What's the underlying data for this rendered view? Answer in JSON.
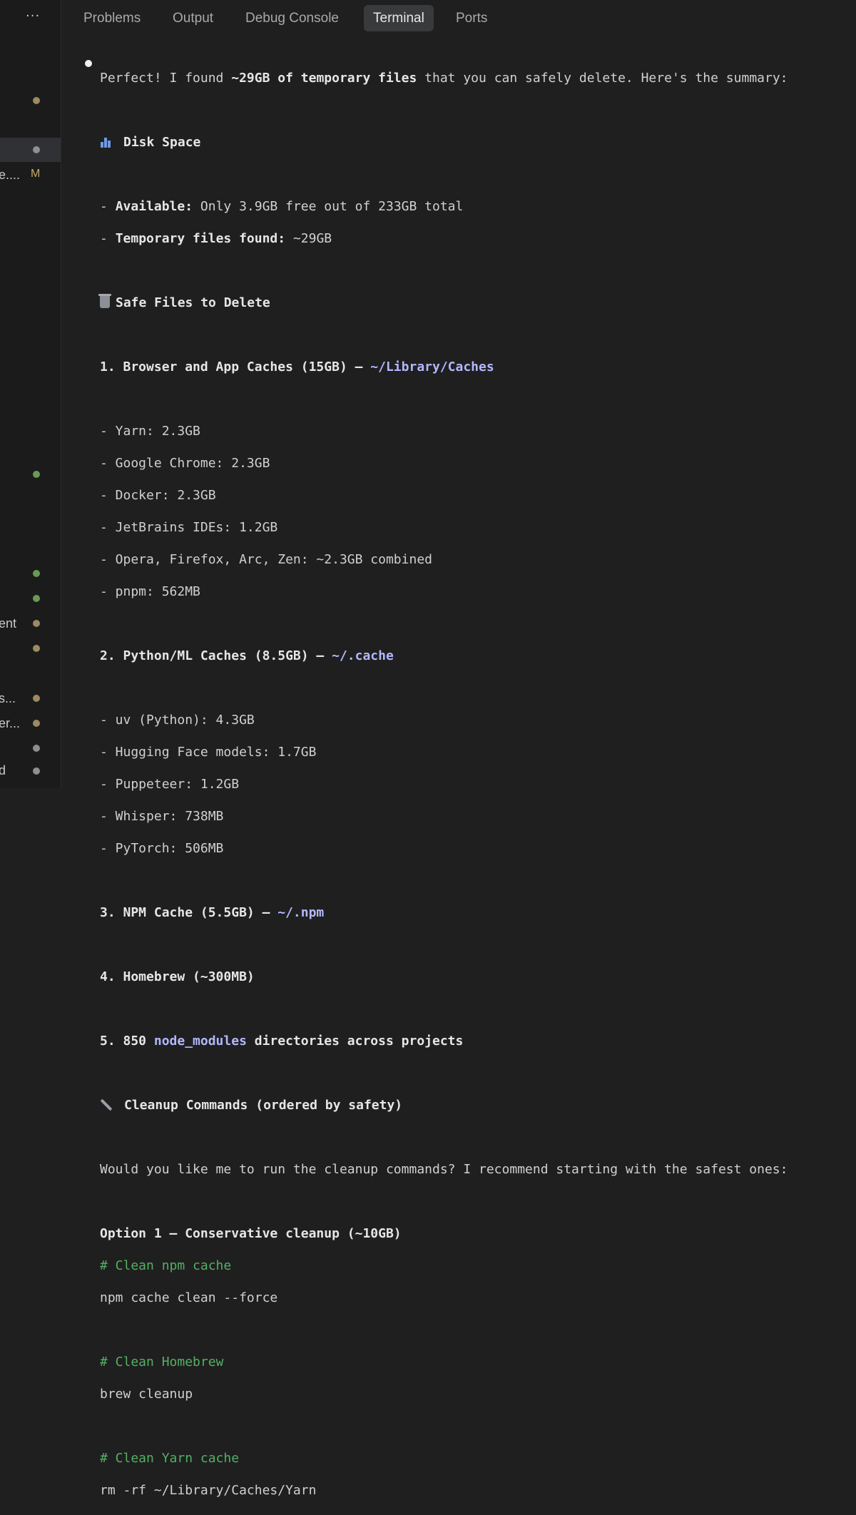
{
  "sidebar": {
    "more_label": "···",
    "items": [
      {
        "text": "e....",
        "badge": "M"
      },
      {
        "text": "ent"
      },
      {
        "text": "s..."
      },
      {
        "text": "er..."
      },
      {
        "text": "d"
      }
    ]
  },
  "tabs": [
    {
      "label": "Problems"
    },
    {
      "label": "Output"
    },
    {
      "label": "Debug Console"
    },
    {
      "label": "Terminal"
    },
    {
      "label": "Ports"
    }
  ],
  "terminal": {
    "intro": {
      "pre": "Perfect! I found ",
      "bold": "~29GB of temporary files",
      "post": " that you can safely delete. Here's the summary:"
    },
    "disk_heading": "Disk Space",
    "available_label": "Available:",
    "available_value": " Only 3.9GB free out of 233GB total",
    "temp_label": "Temporary files found:",
    "temp_value": " ~29GB",
    "safe_heading": "Safe Files to Delete",
    "s1_heading": "1. Browser and App Caches (15GB) – ",
    "s1_path": "~/Library/Caches",
    "s1_items": [
      "- Yarn: 2.3GB",
      "- Google Chrome: 2.3GB",
      "- Docker: 2.3GB",
      "- JetBrains IDEs: 1.2GB",
      "- Opera, Firefox, Arc, Zen: ~2.3GB combined",
      "- pnpm: 562MB"
    ],
    "s2_heading": "2. Python/ML Caches (8.5GB) – ",
    "s2_path": "~/.cache",
    "s2_items": [
      "- uv (Python): 4.3GB",
      "- Hugging Face models: 1.7GB",
      "- Puppeteer: 1.2GB",
      "- Whisper: 738MB",
      "- PyTorch: 506MB"
    ],
    "s3_heading": "3. NPM Cache (5.5GB) – ",
    "s3_path": "~/.npm",
    "s4_heading": "4. Homebrew (~300MB)",
    "s5_pre": "5. 850 ",
    "s5_path": "node_modules",
    "s5_post": " directories across projects",
    "cleanup_heading": "Cleanup Commands (ordered by safety)",
    "question": "Would you like me to run the cleanup commands? I recommend starting with the safest ones:",
    "option1": "Option 1 – Conservative cleanup (~10GB)",
    "cmd1_comment": "# Clean npm cache",
    "cmd1": "npm cache clean --force",
    "cmd2_comment": "# Clean Homebrew",
    "cmd2": "brew cleanup",
    "cmd3_comment": "# Clean Yarn cache",
    "cmd3": "rm -rf ~/Library/Caches/Yarn"
  }
}
